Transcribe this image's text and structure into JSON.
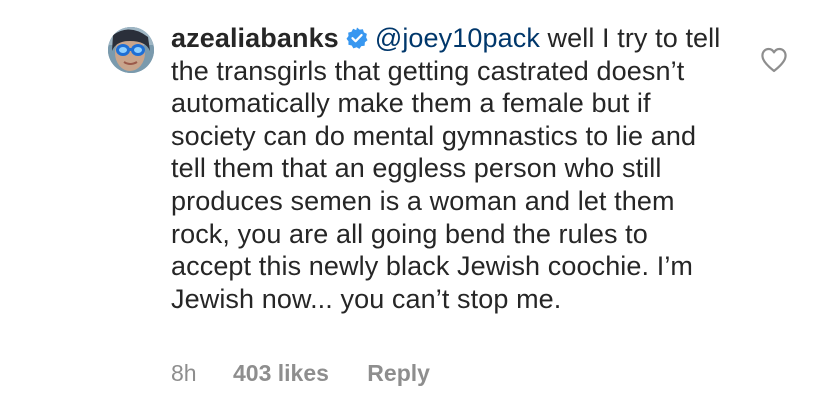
{
  "comment": {
    "username": "azealiabanks",
    "mention": "@joey10pack",
    "text": " well I try to tell the transgirls that getting castrated doesn’t automatically make them a female but if society can do mental gymnastics to lie and tell them that an eggless person who still produces semen is a woman and let them rock, you are all going bend the rules to accept this newly black Jewish coochie. I’m Jewish now... you can’t stop me.",
    "verified_icon": "verified-badge-icon",
    "like_icon": "heart-outline-icon"
  },
  "meta": {
    "time": "8h",
    "likes": "403 likes",
    "reply": "Reply"
  },
  "colors": {
    "text": "#262626",
    "mention": "#00376b",
    "muted": "#8e8e8e",
    "verified": "#3897f0"
  }
}
